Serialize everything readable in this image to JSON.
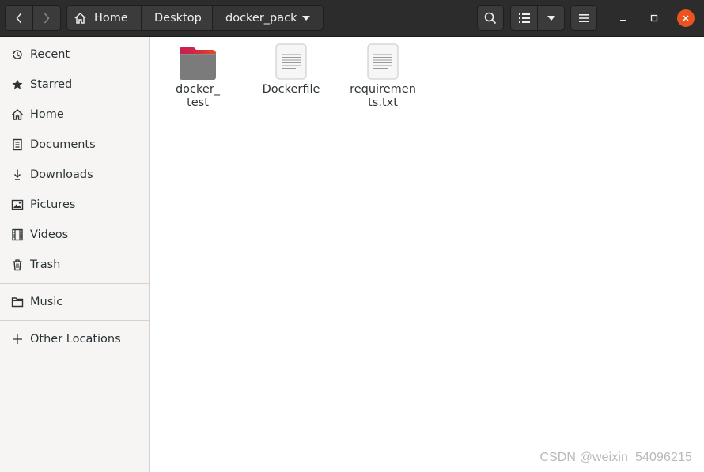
{
  "header": {
    "breadcrumbs": {
      "home": "Home",
      "desktop": "Desktop",
      "current": "docker_pack"
    }
  },
  "sidebar": {
    "items": [
      {
        "label": "Recent",
        "icon": "clock-icon"
      },
      {
        "label": "Starred",
        "icon": "star-icon"
      },
      {
        "label": "Home",
        "icon": "home-icon"
      },
      {
        "label": "Documents",
        "icon": "document-icon"
      },
      {
        "label": "Downloads",
        "icon": "download-icon"
      },
      {
        "label": "Pictures",
        "icon": "picture-icon"
      },
      {
        "label": "Videos",
        "icon": "film-icon"
      },
      {
        "label": "Trash",
        "icon": "trash-icon"
      }
    ],
    "music": {
      "label": "Music",
      "icon": "folder-icon"
    },
    "other": {
      "label": "Other Locations",
      "icon": "plus-icon"
    }
  },
  "files": [
    {
      "name": "docker_\ntest",
      "line1": "docker_",
      "line2": "test",
      "type": "folder"
    },
    {
      "name": "Dockerfile",
      "line1": "Dockerfile",
      "line2": "",
      "type": "text"
    },
    {
      "name": "requirements.txt",
      "line1": "requiremen",
      "line2": "ts.txt",
      "type": "text"
    }
  ],
  "watermark": "CSDN @weixin_54096215",
  "colors": {
    "accent": "#e95420",
    "headerbar": "#2c2c2c",
    "folder": "#7b7b7b",
    "folder_tab": "#c9204e"
  }
}
